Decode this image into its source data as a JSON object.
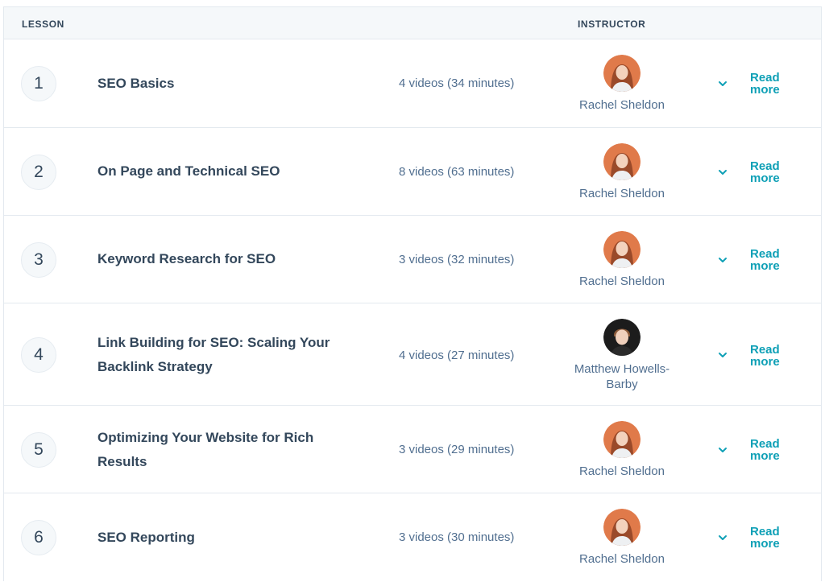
{
  "header": {
    "lesson_label": "LESSON",
    "instructor_label": "INSTRUCTOR"
  },
  "lessons": [
    {
      "number": "1",
      "title": "SEO Basics",
      "videos": "4 videos (34 minutes)",
      "instructor": "Rachel Sheldon",
      "read_more": "Read more"
    },
    {
      "number": "2",
      "title": "On Page and Technical SEO",
      "videos": "8 videos (63 minutes)",
      "instructor": "Rachel Sheldon",
      "read_more": "Read more"
    },
    {
      "number": "3",
      "title": "Keyword Research for SEO",
      "videos": "3 videos (32 minutes)",
      "instructor": "Rachel Sheldon",
      "read_more": "Read more"
    },
    {
      "number": "4",
      "title": "Link Building for SEO: Scaling Your Backlink Strategy",
      "videos": "4 videos (27 minutes)",
      "instructor": "Matthew Howells-Barby",
      "read_more": "Read more"
    },
    {
      "number": "5",
      "title": "Optimizing Your Website for Rich Results",
      "videos": "3 videos (29 minutes)",
      "instructor": "Rachel Sheldon",
      "read_more": "Read more"
    },
    {
      "number": "6",
      "title": "SEO Reporting",
      "videos": "3 videos (30 minutes)",
      "instructor": "Rachel Sheldon",
      "read_more": "Read more"
    }
  ],
  "colors": {
    "accent": "#0fa0b6",
    "text": "#33475b",
    "muted": "#516f90",
    "header_bg": "#f5f8fa"
  }
}
